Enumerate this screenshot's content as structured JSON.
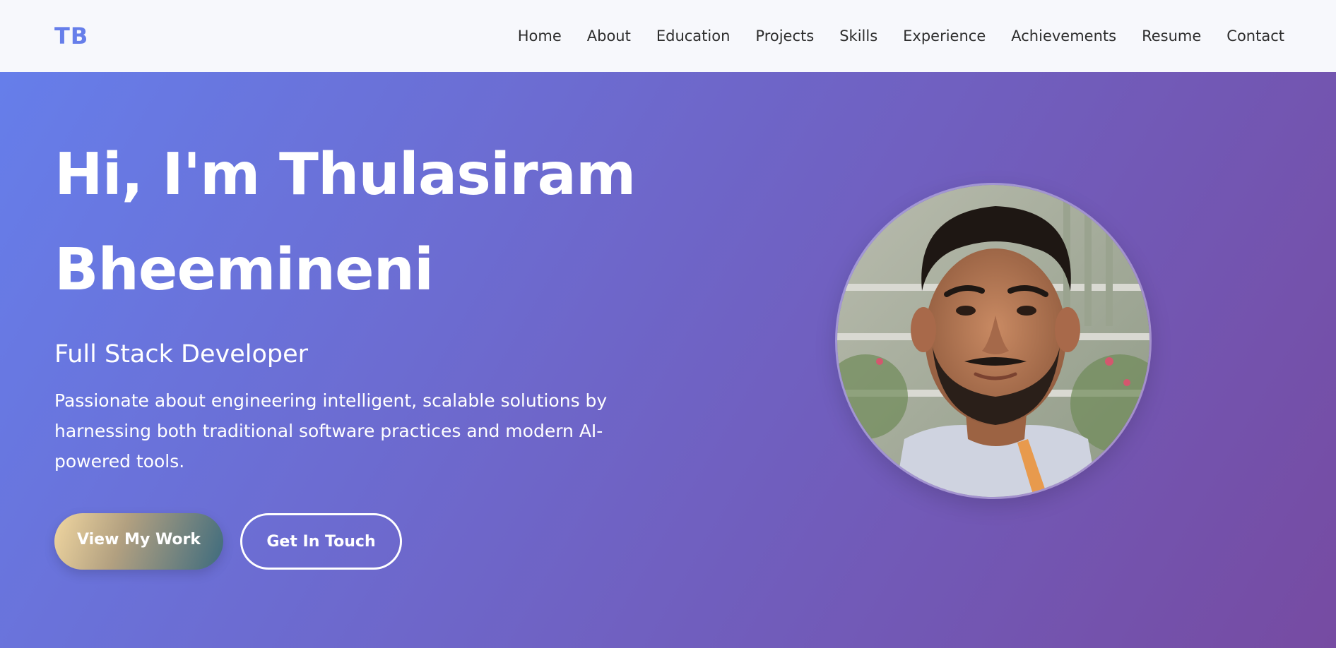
{
  "nav": {
    "logo": "TB",
    "links": [
      "Home",
      "About",
      "Education",
      "Projects",
      "Skills",
      "Experience",
      "Achievements",
      "Resume",
      "Contact"
    ]
  },
  "hero": {
    "title_line1": "Hi, I'm Thulasiram",
    "title_line2": "Bheemineni",
    "subtitle": "Full Stack Developer",
    "description": "Passionate about engineering intelligent, scalable solutions by harnessing both traditional software practices and modern AI-powered tools.",
    "primary_button": "View My Work",
    "secondary_button": "Get In Touch"
  },
  "colors": {
    "logo": "#667eea",
    "gradient_start": "#667eea",
    "gradient_end": "#764ba2"
  }
}
